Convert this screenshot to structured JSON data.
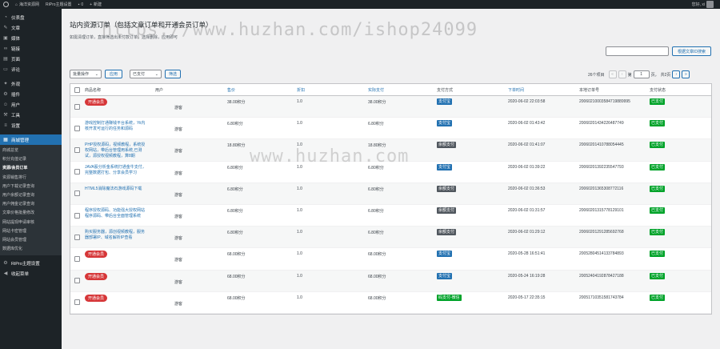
{
  "adminbar": {
    "site_name": "海洋资源网",
    "theme_settings": "RiPro主题设置",
    "comments_count": "0",
    "new_label": "新建",
    "greeting": "您好, xi"
  },
  "sidebar": {
    "top_items": [
      {
        "icon": "dashboard-icon",
        "label": "仪表盘"
      },
      {
        "icon": "pin-icon",
        "label": "文章"
      },
      {
        "icon": "media-icon",
        "label": "媒体"
      },
      {
        "icon": "link-icon",
        "label": "链接"
      },
      {
        "icon": "page-icon",
        "label": "页面"
      },
      {
        "icon": "comment-icon",
        "label": "评论"
      }
    ],
    "mid_items": [
      {
        "icon": "appearance-icon",
        "label": "外观"
      },
      {
        "icon": "plugin-icon",
        "label": "插件"
      },
      {
        "icon": "user-icon",
        "label": "用户"
      },
      {
        "icon": "tools-icon",
        "label": "工具"
      },
      {
        "icon": "settings-icon",
        "label": "设置"
      }
    ],
    "active_item": {
      "icon": "store-icon",
      "label": "商城管理"
    },
    "sub_items": [
      "商城总览",
      "积分充值记录",
      "资源/会员订单",
      "资源销售排行",
      "用户下载记录查询",
      "用户余额记录查询",
      "用户佣金记录查询",
      "文章价格批量修改",
      "网站提现申请审核",
      "网站卡密管理",
      "网站会员管理",
      "数据库优化"
    ],
    "current_sub": "资源/会员订单",
    "bottom_items": [
      {
        "icon": "gear-icon",
        "label": "RiPro主题设置"
      },
      {
        "icon": "collapse-icon",
        "label": "收起菜单"
      }
    ]
  },
  "page": {
    "title": "站内资源订单（包括文章订单和开通会员订单）",
    "description": "如需清理订单，直接筛选出未付款订单，选择删除，应用即可",
    "search_button": "根据文章ID搜索",
    "bulk_action": "批量操作",
    "apply_button": "应用",
    "status_filter": "已支付",
    "filter_button": "筛选",
    "items_count": "26个项目",
    "current_page": "1",
    "total_pages": "共2页"
  },
  "watermark": {
    "line1": "https://www.huzhan.com/ishop24099",
    "line2": "www.huzhan.com"
  },
  "table": {
    "headers": {
      "name": "商品名称",
      "user": "用户",
      "price": "售价",
      "discount": "折扣",
      "paid": "实际支付",
      "method": "支付方式",
      "time": "下单时间",
      "order_no": "本地订单号",
      "status": "支付状态"
    },
    "rows": [
      {
        "name": "开通会员",
        "is_vip": true,
        "user": "游客",
        "price": "38.00积分",
        "discount": "1.0",
        "paid": "38.00积分",
        "method": "支付宝",
        "method_type": "blue",
        "time": "2020-06-02 22:03:58",
        "order_no": "20060210003584719889995",
        "status": "已支付"
      },
      {
        "name": "游戏控制打通赚钱平台系统，Yii内核开发可运行的任务和源码",
        "is_vip": false,
        "user": "游客",
        "price": "6.80积分",
        "discount": "1.0",
        "paid": "6.80积分",
        "method": "支付宝",
        "method_type": "blue",
        "time": "2020-06-02 01:43:42",
        "order_no": "20060201434226487749",
        "status": "已支付"
      },
      {
        "name": "PHP授权源码，视频教程，系统授权网站，带后台管理用系统,已测试，源授权视频教程，算8期",
        "is_vip": false,
        "user": "游客",
        "price": "18.80积分",
        "discount": "1.0",
        "paid": "18.80积分",
        "method": "余额支付",
        "method_type": "dark",
        "time": "2020-06-02 01:41:07",
        "order_no": "20060201410788054445",
        "status": "已支付"
      },
      {
        "name": "JAVA股分析金系统打通金牛支付，完整数据打包、分享会员学习",
        "is_vip": false,
        "user": "游客",
        "price": "6.80积分",
        "discount": "1.0",
        "paid": "6.80积分",
        "method": "支付宝",
        "method_type": "blue",
        "time": "2020-06-02 01:39:22",
        "order_no": "20060201392235547793",
        "status": "已支付"
      },
      {
        "name": "HTML5消除魔法石游戏源码下载",
        "is_vip": false,
        "user": "游客",
        "price": "6.80积分",
        "discount": "1.0",
        "paid": "6.80积分",
        "method": "余额支付",
        "method_type": "dark",
        "time": "2020-06-02 01:36:53",
        "order_no": "20060201365308772116",
        "status": "已支付"
      },
      {
        "name": "程序授权源码、功能强大授权网站程序源码、带后台全面管理系统",
        "is_vip": false,
        "user": "游客",
        "price": "6.80积分",
        "discount": "1.0",
        "paid": "6.80积分",
        "method": "余额支付",
        "method_type": "dark",
        "time": "2020-06-02 01:31:57",
        "order_no": "20060201315778129101",
        "status": "已支付"
      },
      {
        "name": "购买服务器，源创视频教程，服务器部署IP、域名解析IP查看",
        "is_vip": false,
        "user": "游客",
        "price": "6.80积分",
        "discount": "1.0",
        "paid": "6.80积分",
        "method": "余额支付",
        "method_type": "dark",
        "time": "2020-06-02 01:29:12",
        "order_no": "20060201291285692768",
        "status": "已支付"
      },
      {
        "name": "开通会员",
        "is_vip": true,
        "user": "游客",
        "price": "68.00积分",
        "discount": "1.0",
        "paid": "68.00积分",
        "method": "支付宝",
        "method_type": "blue",
        "time": "2020-05-28 16:51:41",
        "order_no": "20052804514133784893",
        "status": "已支付"
      },
      {
        "name": "开通会员",
        "is_vip": true,
        "user": "游客",
        "price": "68.00积分",
        "discount": "1.0",
        "paid": "68.00积分",
        "method": "支付宝",
        "method_type": "blue",
        "time": "2020-05-24 16:19:28",
        "order_no": "20052404192878427188",
        "status": "已支付"
      },
      {
        "name": "开通会员",
        "is_vip": true,
        "user": "游客",
        "price": "68.00积分",
        "discount": "1.0",
        "paid": "68.00积分",
        "method": "码支付-微信",
        "method_type": "green",
        "time": "2020-05-17 22:35:15",
        "order_no": "20051710351581743784",
        "status": "已支付"
      }
    ]
  }
}
